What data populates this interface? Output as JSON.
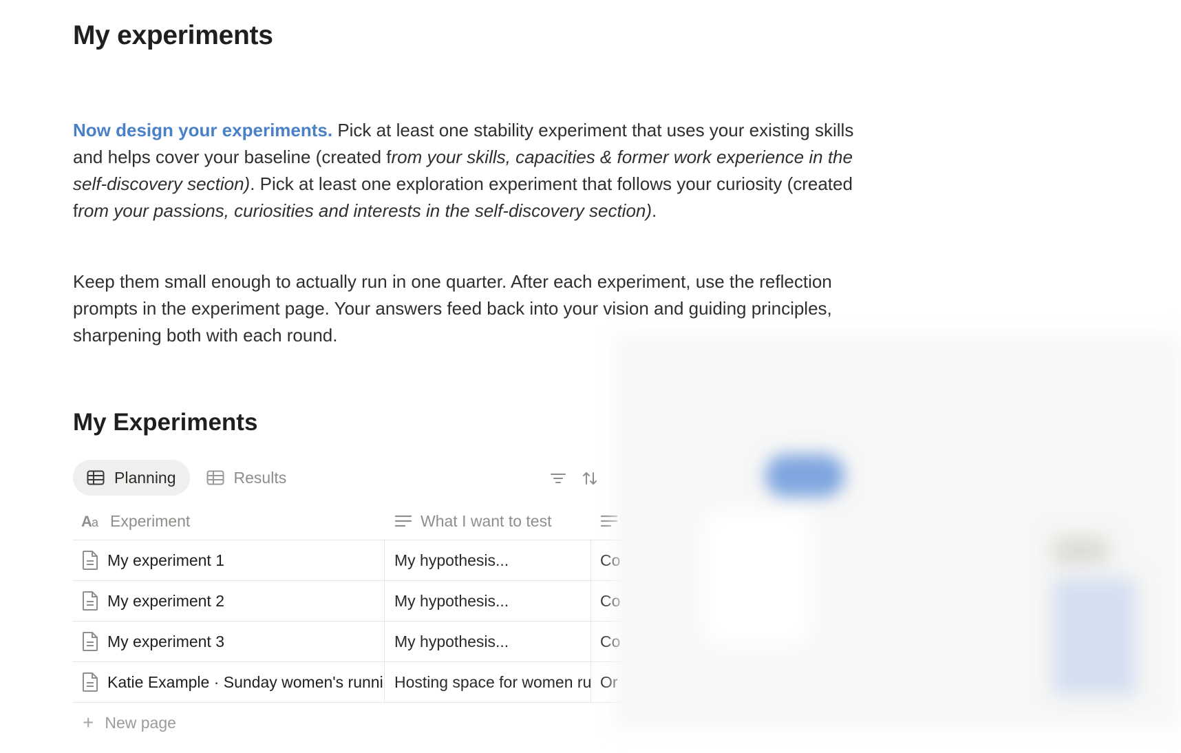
{
  "page": {
    "title": "My experiments"
  },
  "intro": {
    "highlight": "Now design your experiments.",
    "p1_a": " Pick at least one stability experiment that uses your existing skills and helps cover your baseline (created f",
    "p1_b": "rom your skills, capacities & former work experience in the self-discovery section)",
    "p1_c": ". Pick at least one exploration experiment that follows your curiosity (created f",
    "p1_d": "rom your passions, curiosities and interests in the self-discovery section)",
    "p1_e": ".",
    "p2": "Keep them small enough to actually run in one quarter. After each experiment, use the reflection prompts in the experiment page. Your answers feed back into your vision and guiding principles, sharpening both with each round."
  },
  "database": {
    "title": "My Experiments",
    "tabs": [
      {
        "label": "Planning",
        "active": true,
        "icon": "table-icon"
      },
      {
        "label": "Results",
        "active": false,
        "icon": "table-icon"
      }
    ],
    "columns": [
      {
        "label": "Experiment",
        "icon": "title-property-icon"
      },
      {
        "label": "What I want to test",
        "icon": "text-property-icon"
      },
      {
        "label": "",
        "icon": "text-property-icon"
      }
    ],
    "rows": [
      {
        "name": "My experiment 1",
        "test": "My hypothesis...",
        "col3": "Co"
      },
      {
        "name": "My experiment 2",
        "test": "My hypothesis...",
        "col3": "Co"
      },
      {
        "name": "My experiment 3",
        "test": "My hypothesis...",
        "col3": "Co"
      },
      {
        "name": "Katie Example · Sunday women's running club",
        "test": "Hosting space for women runners",
        "col3": "Or"
      }
    ],
    "new_page_label": "New page"
  }
}
